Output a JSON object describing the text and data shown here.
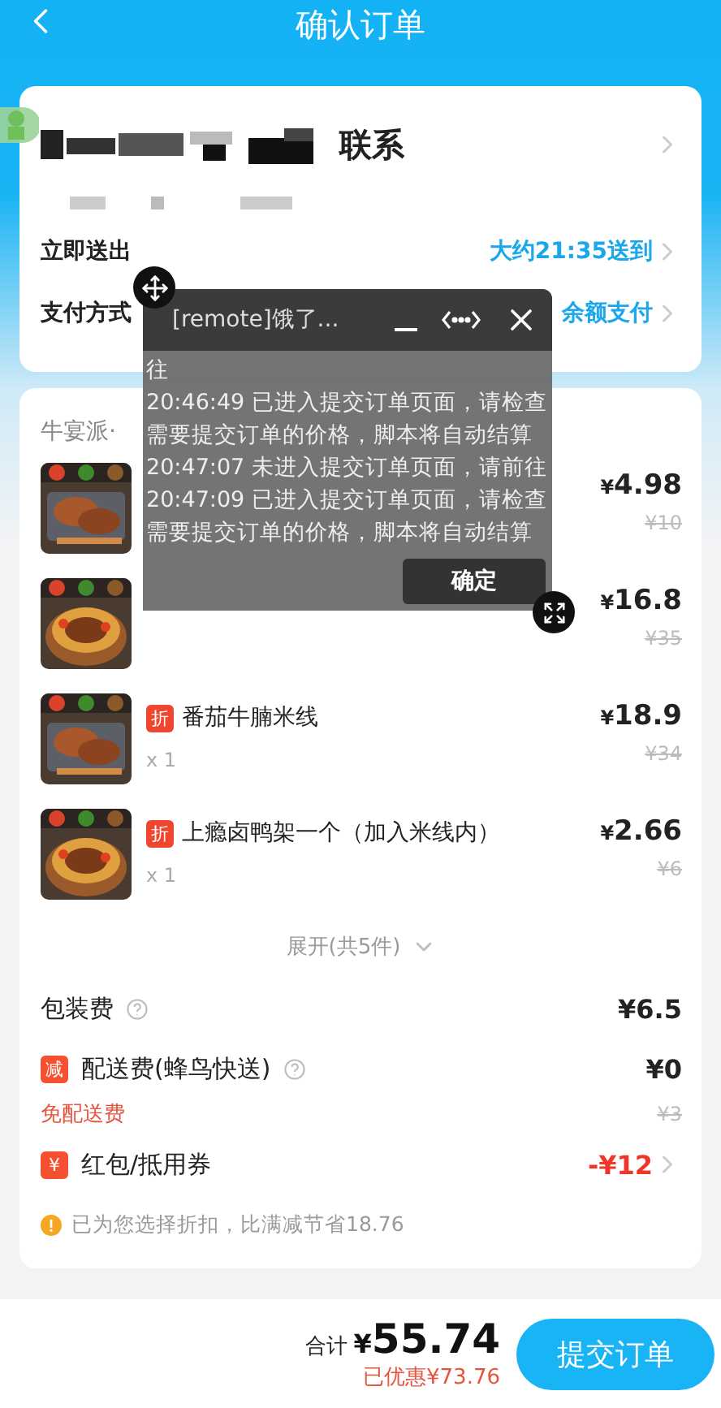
{
  "header": {
    "title": "确认订单"
  },
  "address": {
    "tail": "联系"
  },
  "rows": [
    {
      "label": "立即送出",
      "value": "大约21:35送到"
    },
    {
      "label": "支付方式",
      "value": "余额支付"
    }
  ],
  "store": {
    "name": "牛宴派·"
  },
  "items": [
    {
      "currency": "¥",
      "price": "4.98",
      "original": "¥10"
    },
    {
      "currency": "¥",
      "price": "16.8",
      "original": "¥35"
    },
    {
      "badge": "折",
      "name": "番茄牛腩米线",
      "qty": "x 1",
      "currency": "¥",
      "price": "18.9",
      "original": "¥34"
    },
    {
      "badge": "折",
      "name": "上瘾卤鸭架一个（加入米线内）",
      "qty": "x 1",
      "currency": "¥",
      "price": "2.66",
      "original": "¥6"
    }
  ],
  "expand": "展开(共5件)",
  "fees": [
    {
      "kind": "plain",
      "label": "包装费",
      "help": true,
      "amount": "¥6.5"
    },
    {
      "kind": "badge",
      "badge": "减",
      "label": "配送费(蜂鸟快送)",
      "help": true,
      "amount": "¥0",
      "note": "免配送费",
      "original": "¥3"
    },
    {
      "kind": "badge",
      "badge": "¥",
      "label": "红包/抵用券",
      "help": false,
      "amount": "-¥12",
      "highlight": true,
      "link": true
    }
  ],
  "notice": "已为您选择折扣，比满减节省18.76",
  "footer": {
    "total_label": "合计",
    "currency": "¥",
    "total": "55.74",
    "saved": "已优惠¥73.76",
    "submit": "提交订单"
  },
  "overlay": {
    "title": "[remote]饿了...",
    "log": [
      "往",
      "20:46:49 已进入提交订单页面，请检查需要提交订单的价格，脚本将自动结算",
      "20:47:07 未进入提交订单页面，请前往",
      "20:47:09 已进入提交订单页面，请检查需要提交订单的价格，脚本将自动结算"
    ],
    "confirm": "确定"
  }
}
